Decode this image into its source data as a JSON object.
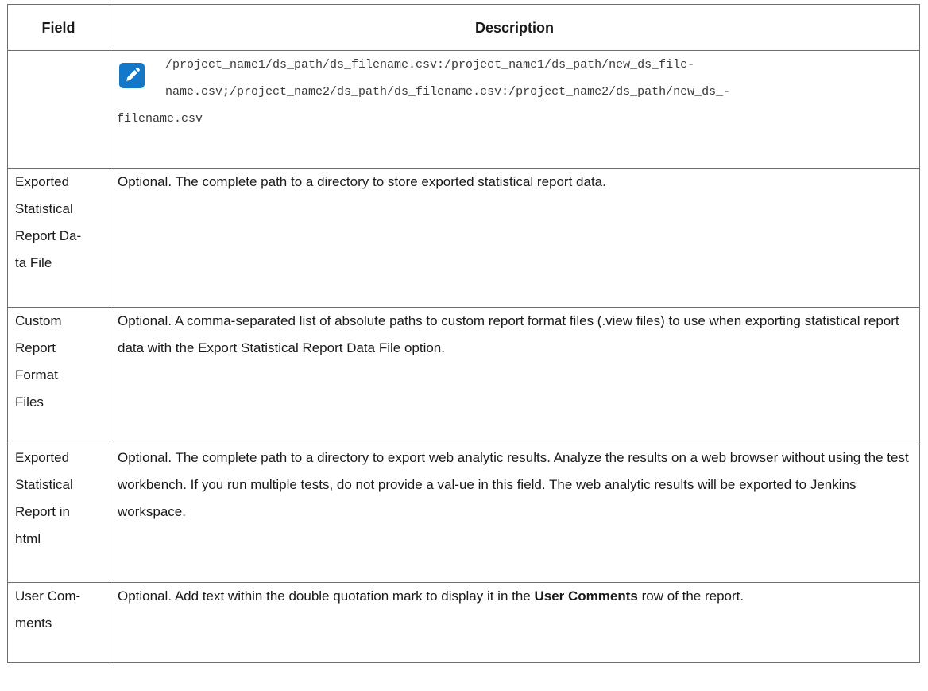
{
  "table": {
    "headers": {
      "field": "Field",
      "description": "Description"
    },
    "note_icon": "pencil-icon",
    "note_lines": [
      "/project_name1/ds_path/ds_filename.csv:/project_name1/ds_path/new_ds_file-",
      "name.csv;/project_name2/ds_path/ds_filename.csv:/project_name2/ds_path/new_ds_-",
      "filename.csv"
    ],
    "rows": [
      {
        "field_lines": [
          "Exported",
          "Statistical",
          "Report Da-",
          "ta File"
        ],
        "description": "Optional. The complete path to a directory to store exported statistical report data."
      },
      {
        "field_lines": [
          "Custom",
          "Report",
          "Format",
          "Files"
        ],
        "description": "Optional. A comma-separated list of absolute paths to custom report format files (.view files) to use when exporting statistical report data with the Export Statistical Report Data File option."
      },
      {
        "field_lines": [
          "Exported",
          "Statistical",
          "Report in",
          "html"
        ],
        "description": "Optional. The complete path to a directory to export web analytic results. Analyze the results on a web browser without using the test workbench. If you run multiple tests, do not provide a val-ue in this field. The web analytic results will be exported to Jenkins workspace."
      },
      {
        "field_lines": [
          "User Com-",
          "ments"
        ],
        "description_before": "Optional. Add text within the double quotation mark to display it in the ",
        "description_bold": "User Comments",
        "description_after": " row of the report."
      }
    ]
  }
}
